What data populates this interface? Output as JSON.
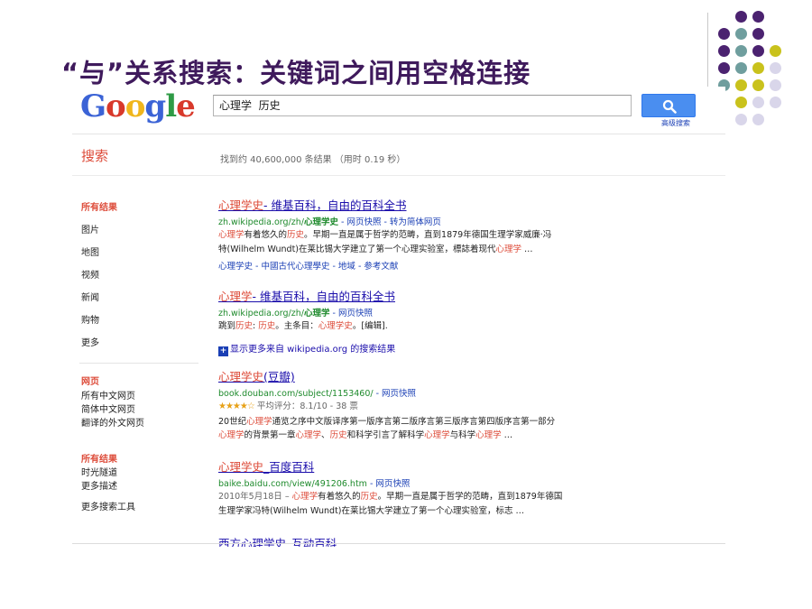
{
  "slide": {
    "title": "“与”关系搜索：关键词之间用空格连接",
    "title_color": "#3f1a5c",
    "dot_colors": [
      "#4b2270",
      "#6f9e9e",
      "#c9c21c",
      "#d9d6ea"
    ]
  },
  "google": {
    "logo_letters": [
      "G",
      "o",
      "o",
      "g",
      "l",
      "e"
    ],
    "logo_colors": [
      "#3b63d6",
      "#d8392b",
      "#f0b61c",
      "#3b63d6",
      "#2f9b46",
      "#d8392b"
    ],
    "search_value": "心理学  历史",
    "search_button_icon": "magnifier-icon",
    "advanced_search": "高级搜索",
    "search_label": "搜索",
    "result_stats": "找到约 40,600,000 条结果  （用时 0.19 秒）"
  },
  "sidebar": {
    "group1": [
      "所有结果",
      "图片",
      "地图",
      "视频",
      "新闻",
      "购物",
      "更多"
    ],
    "group2": [
      "网页",
      "所有中文网页",
      "简体中文网页",
      "翻译的外文网页"
    ],
    "group3": [
      "所有结果",
      "时光隧道",
      "更多描述",
      "更多搜索工具"
    ]
  },
  "results": [
    {
      "title_hl": "心理学史",
      "title_rest": "- 维基百科，自由的百科全书",
      "url_prefix": "zh.wikipedia.org/zh/",
      "url_hl": "心理学史",
      "url_links": " - 网页快照 - 转为简体网页",
      "snippet1_hl": "心理学",
      "snippet1_a": "有着悠久的",
      "snippet1_hl2": "历史",
      "snippet1_b": "。早期一直是属于哲学的范畴，直到1879年德国生理学家威廉·冯",
      "snippet2_a": "特(Wilhelm Wundt)在莱比锡大学建立了第一个心理实验室，標誌着现代",
      "snippet2_hl": "心理学",
      "snippet2_b": " …",
      "sitelinks": "心理学史 - 中國古代心理學史 - 地域 - 参考文献"
    },
    {
      "title_hl": "心理学",
      "title_rest": "- 维基百科，自由的百科全书",
      "url_prefix": "zh.wikipedia.org/zh/",
      "url_hl": "心理学",
      "url_links": " - 网页快照",
      "snippet1_a": "跳到",
      "snippet1_hl": "历史",
      "snippet1_b": ": ",
      "snippet1_hl2": "历史",
      "snippet1_c": "。主条目：",
      "snippet1_hl3": "心理学史",
      "snippet1_d": "。[编辑]."
    },
    {
      "title_hl": "心理学史",
      "title_rest": "(豆瓣)",
      "url_prefix": "book.douban.com/subject/1153460/",
      "url_links": " - 网页快照",
      "rating_stars": "★★★★☆",
      "rating_text": " 平均评分：8.1/10 - 38 票",
      "snippet1_a": "20世纪",
      "snippet1_hl": "心理学",
      "snippet1_b": "通览之序中文版译序第一版序言第二版序言第三版序言第四版序言第一部分",
      "snippet2_hl": "心理学",
      "snippet2_a": "的背景第一章",
      "snippet2_hl2": "心理学",
      "snippet2_b": "、",
      "snippet2_hl3": "历史",
      "snippet2_c": "和科学引言了解科学",
      "snippet2_hl4": "心理学",
      "snippet2_d": "与科学",
      "snippet2_hl5": "心理学",
      "snippet2_e": " …"
    },
    {
      "title_hl": "心理学史",
      "title_rest": "_百度百科",
      "url_prefix": "baike.baidu.com/view/491206.htm",
      "url_links": " - 网页快照",
      "snippet1_date": "2010年5月18日 – ",
      "snippet1_hl": "心理学",
      "snippet1_a": "有着悠久的",
      "snippet1_hl2": "历史",
      "snippet1_b": "。早期一直是属于哲学的范畴，直到1879年德国",
      "snippet2_a": "生理学家冯特(Wilhelm Wundt)在莱比锡大学建立了第一个心理实验室，标志 …"
    }
  ],
  "more_results": "显示更多来自 wikipedia.org 的搜索结果",
  "clipped_title": "西方心理学史_互动百科"
}
